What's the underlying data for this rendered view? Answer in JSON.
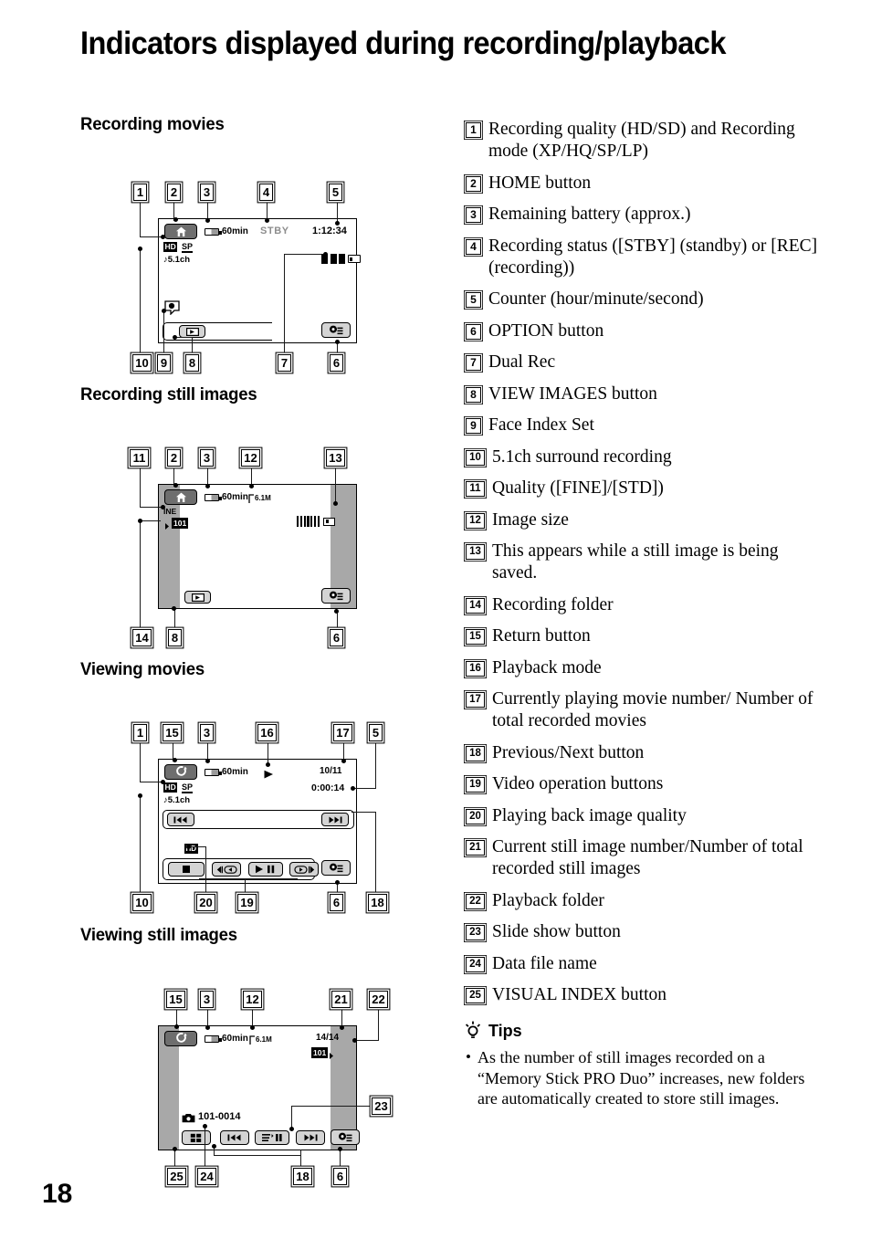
{
  "page": {
    "title": "Indicators displayed during recording/playback",
    "number": "18"
  },
  "sections": [
    {
      "heading": "Recording movies"
    },
    {
      "heading": "Recording still images"
    },
    {
      "heading": "Viewing movies"
    },
    {
      "heading": "Viewing still images"
    }
  ],
  "screens": {
    "recording_movies": {
      "callouts_top": [
        "1",
        "2",
        "3",
        "4",
        "5"
      ],
      "callouts_bottom": [
        "10",
        "9",
        "8",
        "7",
        "6"
      ],
      "battery_text": "60min",
      "status_text": "STBY",
      "counter_text": "1:12:34",
      "quality_badge": "HD",
      "mode_badge": "SP",
      "audio_text": "5.1ch",
      "home_icon": "house-icon",
      "option_icon": "option-gear-icon",
      "view_images_icon": "view-images-icon",
      "face_index_icon": "face-index-icon",
      "dual_rec_icon": "dual-rec-icon"
    },
    "recording_still": {
      "callouts_top": [
        "11",
        "2",
        "3",
        "12",
        "13"
      ],
      "callouts_bottom": [
        "14",
        "8",
        "6"
      ],
      "battery_text": "60min",
      "size_text": "6.1M",
      "quality_text": "INE",
      "folder_badge": "101",
      "home_icon": "house-icon",
      "option_icon": "option-gear-icon",
      "view_images_icon": "view-images-icon",
      "saving_icon": "saving-bars-icon"
    },
    "viewing_movies": {
      "callouts_top": [
        "1",
        "15",
        "3",
        "16",
        "17",
        "5"
      ],
      "callouts_bottom": [
        "10",
        "20",
        "19",
        "6",
        "18"
      ],
      "battery_text": "60min",
      "movie_number": "10/11",
      "counter_text": "0:00:14",
      "quality_badge": "HD",
      "mode_badge": "SP",
      "audio_text": "5.1ch",
      "playback_quality_badge": "HD",
      "return_icon": "return-arrow-icon",
      "playback_mode_icon": "play-triangle-icon",
      "prev_icon": "skip-previous-icon",
      "next_icon": "skip-next-icon",
      "stop_icon": "stop-square-icon",
      "rewind_icon": "frame-reverse-icon",
      "play_pause_icon": "play-pause-icon",
      "forward_icon": "frame-advance-icon",
      "option_icon": "option-gear-icon"
    },
    "viewing_still": {
      "callouts_top": [
        "15",
        "3",
        "12",
        "21",
        "22"
      ],
      "callouts_right": [
        "23"
      ],
      "callouts_bottom": [
        "25",
        "24",
        "18",
        "6"
      ],
      "battery_text": "60min",
      "size_text": "6.1M",
      "image_number": "14/14",
      "folder_badge": "101",
      "file_name": "101-0014",
      "return_icon": "return-arrow-icon",
      "visual_index_icon": "visual-index-icon",
      "prev_icon": "skip-previous-icon",
      "next_icon": "skip-next-icon",
      "slideshow_icon": "slideshow-pause-icon",
      "option_icon": "option-gear-icon",
      "camera_icon": "camera-icon"
    }
  },
  "legend": [
    {
      "num": "1",
      "text": "Recording quality (HD/SD) and Recording mode (XP/HQ/SP/LP)"
    },
    {
      "num": "2",
      "text": "HOME button"
    },
    {
      "num": "3",
      "text": "Remaining battery (approx.)"
    },
    {
      "num": "4",
      "text": "Recording status ([STBY] (standby) or [REC] (recording))"
    },
    {
      "num": "5",
      "text": "Counter (hour/minute/second)"
    },
    {
      "num": "6",
      "text": "OPTION button"
    },
    {
      "num": "7",
      "text": "Dual Rec"
    },
    {
      "num": "8",
      "text": "VIEW IMAGES button"
    },
    {
      "num": "9",
      "text": "Face Index Set"
    },
    {
      "num": "10",
      "text": "5.1ch surround recording"
    },
    {
      "num": "11",
      "text": "Quality ([FINE]/[STD])"
    },
    {
      "num": "12",
      "text": "Image size"
    },
    {
      "num": "13",
      "text": "This appears while a still image is being saved."
    },
    {
      "num": "14",
      "text": "Recording folder"
    },
    {
      "num": "15",
      "text": "Return button"
    },
    {
      "num": "16",
      "text": "Playback mode"
    },
    {
      "num": "17",
      "text": "Currently playing movie number/ Number of total recorded movies"
    },
    {
      "num": "18",
      "text": "Previous/Next button"
    },
    {
      "num": "19",
      "text": "Video operation buttons"
    },
    {
      "num": "20",
      "text": "Playing back image quality"
    },
    {
      "num": "21",
      "text": "Current still image number/Number of total recorded still images"
    },
    {
      "num": "22",
      "text": "Playback folder"
    },
    {
      "num": "23",
      "text": "Slide show button"
    },
    {
      "num": "24",
      "text": "Data file name"
    },
    {
      "num": "25",
      "text": "VISUAL INDEX button"
    }
  ],
  "tips": {
    "heading": "Tips",
    "bullet": "•",
    "text": "As the number of still images recorded on a “Memory Stick PRO Duo” increases, new folders are automatically created to store still images.",
    "icon": "lightbulb-icon"
  }
}
